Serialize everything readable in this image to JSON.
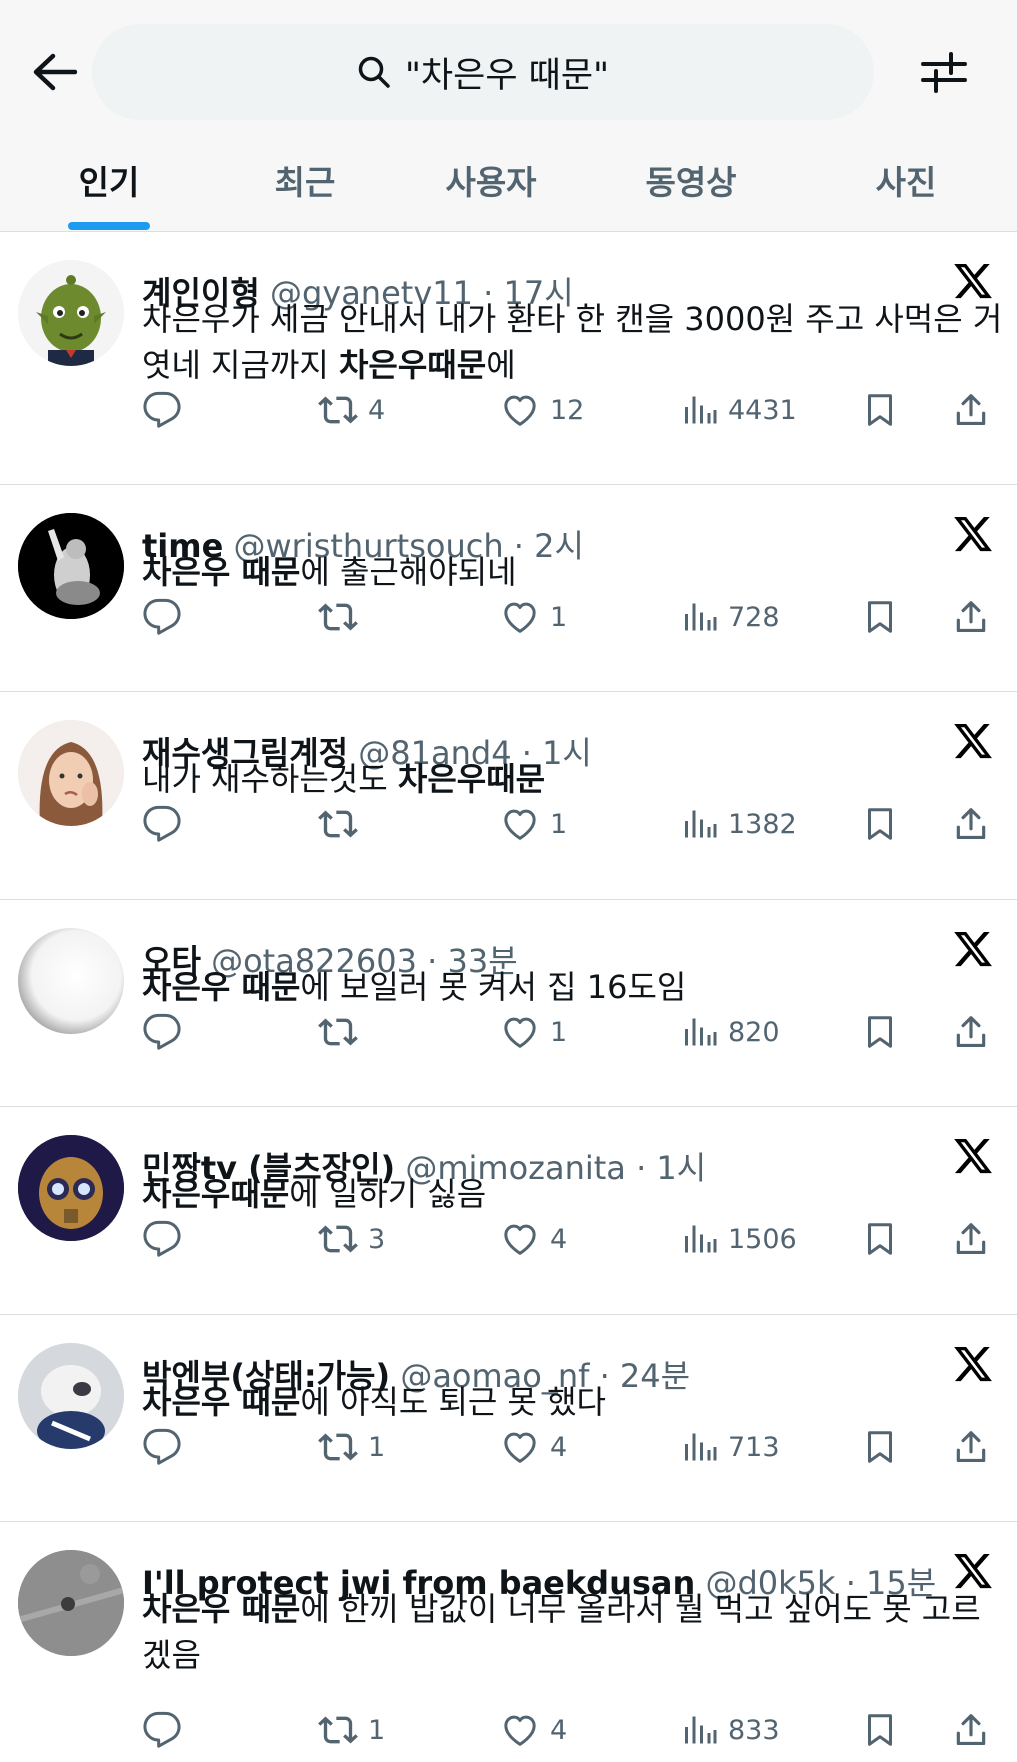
{
  "search": {
    "query": "\"차은우 때문\""
  },
  "icons": {
    "back": "arrow-left-icon",
    "search": "search-icon",
    "filter": "filter-sliders-icon",
    "reply": "reply-icon",
    "retweet": "retweet-icon",
    "like": "heart-icon",
    "views": "views-icon",
    "bookmark": "bookmark-icon",
    "share": "share-icon",
    "x_logo": "x-logo-icon"
  },
  "colors": {
    "accent": "#1d9bf0",
    "text": "#0f1419",
    "muted": "#536471"
  },
  "tabs": [
    {
      "label": "인기",
      "active": true
    },
    {
      "label": "최근"
    },
    {
      "label": "사용자"
    },
    {
      "label": "동영상"
    },
    {
      "label": "사진"
    }
  ],
  "tweets": [
    {
      "name": "계인이형",
      "handle_time": "@gyanetv11 · 17시",
      "body": [
        {
          "text": "차은우가 세금 안내서 내가 환타 한 캔을 3000원 주고 사먹은 거엿네 지금까지 "
        },
        {
          "text": "차은우때문",
          "bold": true
        },
        {
          "text": "에"
        }
      ],
      "retweets": "4",
      "likes": "12",
      "views": "4431"
    },
    {
      "name": "time",
      "handle_time": "@wristhurtsouch · 2시",
      "body": [
        {
          "text": "차은우 때문",
          "bold": true
        },
        {
          "text": "에 출근해야되네"
        }
      ],
      "retweets": "",
      "likes": "1",
      "views": "728"
    },
    {
      "name": "재수생그림계정",
      "handle_time": "@81and4 · 1시",
      "body": [
        {
          "text": "내가 재수하는것도 "
        },
        {
          "text": "차은우때문",
          "bold": true
        }
      ],
      "retweets": "",
      "likes": "1",
      "views": "1382"
    },
    {
      "name": "오타",
      "handle_time": "@ota822603 · 33분",
      "body": [
        {
          "text": "차은우 때문",
          "bold": true
        },
        {
          "text": "에 보일러 못 켜서 집 16도임"
        }
      ],
      "retweets": "",
      "likes": "1",
      "views": "820"
    },
    {
      "name": "민짱tv (블츠장인)",
      "handle_time": "@mimozanita · 1시",
      "body": [
        {
          "text": "차은우때문",
          "bold": true
        },
        {
          "text": "에 일하기 싫음"
        }
      ],
      "retweets": "3",
      "likes": "4",
      "views": "1506"
    },
    {
      "name": "박엔부(상태:가능)",
      "handle_time": "@aomao_nf · 24분",
      "body": [
        {
          "text": "차은우 때문",
          "bold": true
        },
        {
          "text": "에 아직도 퇴근 못 했다"
        }
      ],
      "retweets": "1",
      "likes": "4",
      "views": "713"
    },
    {
      "name": "I'll protect jwi from baekdusan",
      "handle_time": "@d0k5k · 15분",
      "body": [
        {
          "text": "차은우 때문",
          "bold": true
        },
        {
          "text": "에 한끼 밥값이 너무 올라서 뭘 먹고 싶어도 못 고르겠음"
        }
      ],
      "retweets": "1",
      "likes": "4",
      "views": "833"
    }
  ]
}
